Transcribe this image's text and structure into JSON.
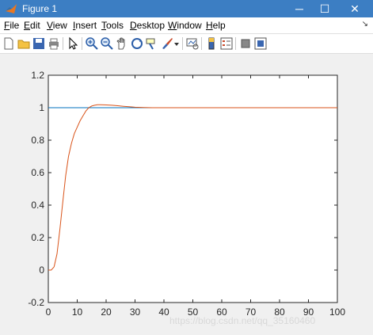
{
  "window": {
    "title": "Figure 1",
    "controls": {
      "minimize": "─",
      "maximize": "☐",
      "close": "✕"
    }
  },
  "menu": [
    {
      "label": "File",
      "key": "F",
      "rest": "ile"
    },
    {
      "label": "Edit",
      "key": "E",
      "rest": "dit"
    },
    {
      "label": "View",
      "key": "V",
      "rest": "iew"
    },
    {
      "label": "Insert",
      "key": "I",
      "rest": "nsert"
    },
    {
      "label": "Tools",
      "key": "T",
      "rest": "ools"
    },
    {
      "label": "Desktop",
      "key": "D",
      "rest": "esktop"
    },
    {
      "label": "Window",
      "key": "W",
      "rest": "indow"
    },
    {
      "label": "Help",
      "key": "H",
      "rest": "elp"
    }
  ],
  "toolbar_icons": [
    "new-figure-icon",
    "open-file-icon",
    "save-icon",
    "print-icon",
    "select-arrow-icon",
    "zoom-in-icon",
    "zoom-out-icon",
    "pan-hand-icon",
    "rotate-3d-icon",
    "data-cursor-icon",
    "brush-icon",
    "brush-dropdown-icon",
    "link-plot-icon",
    "colorbar-icon",
    "legend-icon",
    "hide-plot-tools-icon",
    "show-plot-tools-icon"
  ],
  "colors": {
    "title_bar": "#3c7ec3",
    "reference_line": "#0072bd",
    "response_line": "#d95319",
    "axes_bg": "#ffffff",
    "figure_bg": "#f0f0f0"
  },
  "chart_data": {
    "type": "line",
    "xlim": [
      0,
      100
    ],
    "ylim": [
      -0.2,
      1.2
    ],
    "xticks": [
      0,
      10,
      20,
      30,
      40,
      50,
      60,
      70,
      80,
      90,
      100
    ],
    "yticks": [
      "-0.2",
      "0",
      "0.2",
      "0.4",
      "0.6",
      "0.8",
      "1",
      "1.2"
    ],
    "grid": false,
    "series": [
      {
        "x": [
          0,
          100
        ],
        "y": [
          1,
          1
        ]
      },
      {
        "x": [
          0,
          1,
          2,
          3,
          4,
          5,
          6,
          7,
          8,
          9,
          10,
          11,
          12,
          13,
          14,
          15,
          16,
          17,
          18,
          20,
          22,
          24,
          26,
          28,
          30,
          33,
          36,
          40,
          50,
          60,
          80,
          100
        ],
        "y": [
          0,
          0.0,
          0.02,
          0.1,
          0.25,
          0.42,
          0.58,
          0.7,
          0.78,
          0.84,
          0.88,
          0.92,
          0.95,
          0.98,
          1.0,
          1.01,
          1.015,
          1.018,
          1.018,
          1.017,
          1.015,
          1.012,
          1.009,
          1.006,
          1.003,
          1.001,
          1.0,
          1.0,
          1.0,
          1.0,
          1.0,
          1.0
        ]
      }
    ]
  },
  "watermark": "https://blog.csdn.net/qq_35160460"
}
